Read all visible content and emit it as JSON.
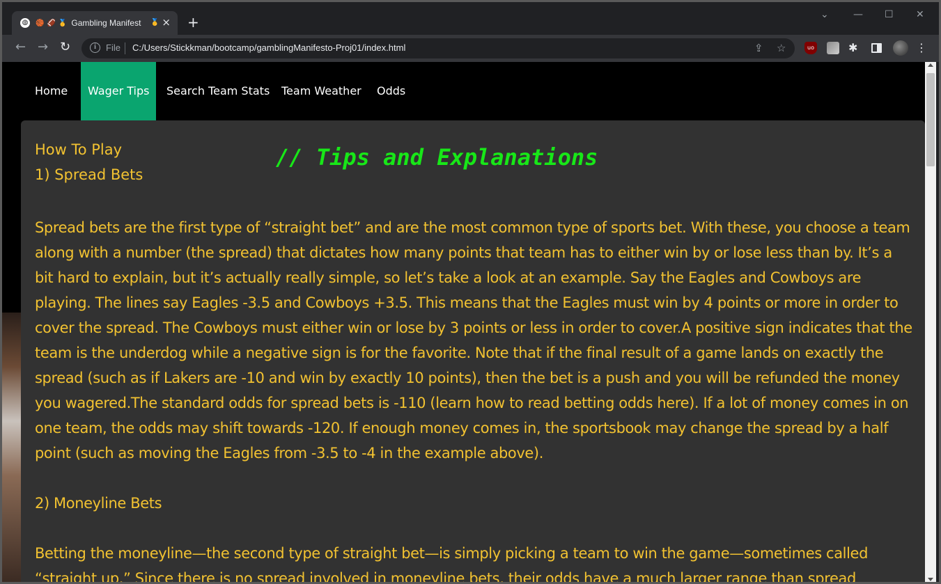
{
  "browser": {
    "tab_title": "Gambling Manifest",
    "tab_emoji_1": "🏀",
    "tab_emoji_2": "🏈",
    "tab_emoji_3": "🥇",
    "tab_emoji_4": "🥇",
    "omnibox_label": "File",
    "url": "C:/Users/Stickkman/bootcamp/gamblingManifesto-Proj01/index.html",
    "icons": [
      "globe-icon",
      "close-icon",
      "new-tab-icon",
      "back-icon",
      "forward-icon",
      "reload-icon",
      "info-icon",
      "share-icon",
      "bookmark-star-icon",
      "ublock-icon",
      "extension-icon",
      "puzzle-icon",
      "side-panel-icon",
      "profile-avatar",
      "kebab-menu-icon",
      "chevron-down-icon",
      "minimize-icon",
      "maximize-icon",
      "window-close-icon"
    ]
  },
  "nav": {
    "items": [
      {
        "label": "Home",
        "active": false
      },
      {
        "label": "Wager Tips",
        "active": true
      },
      {
        "label": "Search Team Stats",
        "active": false
      },
      {
        "label": "Team Weather",
        "active": false
      },
      {
        "label": "Odds",
        "active": false
      }
    ],
    "active_color": "#0aa56f"
  },
  "content": {
    "how_to_play": "How To Play",
    "title": "// Tips and Explanations",
    "section1_heading": "1) Spread Bets",
    "section1_text": "Spread bets are the first type of “straight bet” and are the most common type of sports bet. With these, you choose a team along with a number (the spread) that dictates how many points that team has to either win by or lose less than by. It’s a bit hard to explain, but it’s actually really simple, so let’s take a look at an example. Say the Eagles and Cowboys are playing. The lines say Eagles -3.5 and Cowboys +3.5. This means that the Eagles must win by 4 points or more in order to cover the spread. The Cowboys must either win or lose by 3 points or less in order to cover.A positive sign indicates that the team is the underdog while a negative sign is for the favorite. Note that if the final result of a game lands on exactly the spread (such as if Lakers are -10 and win by exactly 10 points), then the bet is a push and you will be refunded the money you wagered.The standard odds for spread bets is -110 (learn how to read betting odds here). If a lot of money comes in on one team, the odds may shift towards -120. If enough money comes in, the sportsbook may change the spread by a half point (such as moving the Eagles from -3.5 to -4 in the example above).",
    "section2_heading": "2) Moneyline Bets",
    "section2_text": "Betting the moneyline—the second type of straight bet—is simply picking a team to win the game—sometimes called “straight up.” Since there is no spread involved in moneyline bets, their odds have a much larger range than spread",
    "text_color": "#f2c231",
    "title_color": "#18e718"
  }
}
